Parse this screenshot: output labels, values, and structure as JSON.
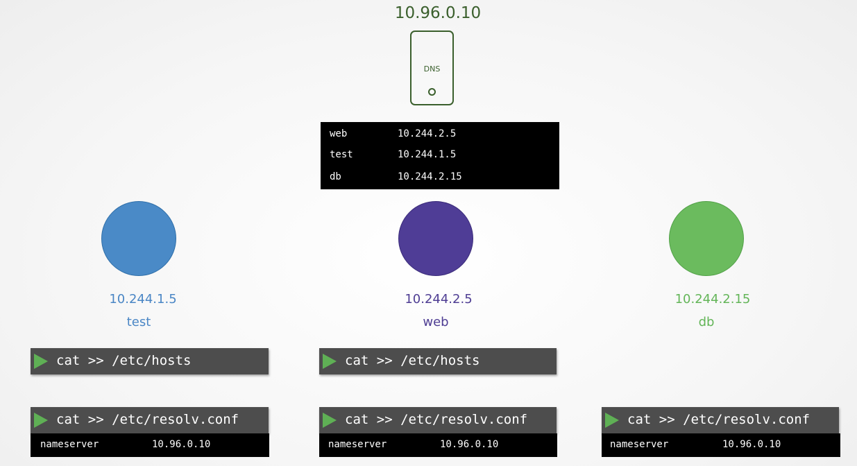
{
  "dns": {
    "ip": "10.96.0.10",
    "label": "DNS",
    "records": [
      {
        "name": "web",
        "ip": "10.244.2.5"
      },
      {
        "name": "test",
        "ip": "10.244.1.5"
      },
      {
        "name": "db",
        "ip": "10.244.2.15"
      }
    ]
  },
  "pods": [
    {
      "ip": "10.244.1.5",
      "name": "test",
      "color": "#4a8ac7"
    },
    {
      "ip": "10.244.2.5",
      "name": "web",
      "color": "#4f3d96"
    },
    {
      "ip": "10.244.2.15",
      "name": "db",
      "color": "#6bbb5e"
    }
  ],
  "commands": {
    "hosts": "cat >> /etc/hosts",
    "resolv": "cat >> /etc/resolv.conf"
  },
  "resolv_output": {
    "key": "nameserver",
    "value": "10.96.0.10"
  }
}
